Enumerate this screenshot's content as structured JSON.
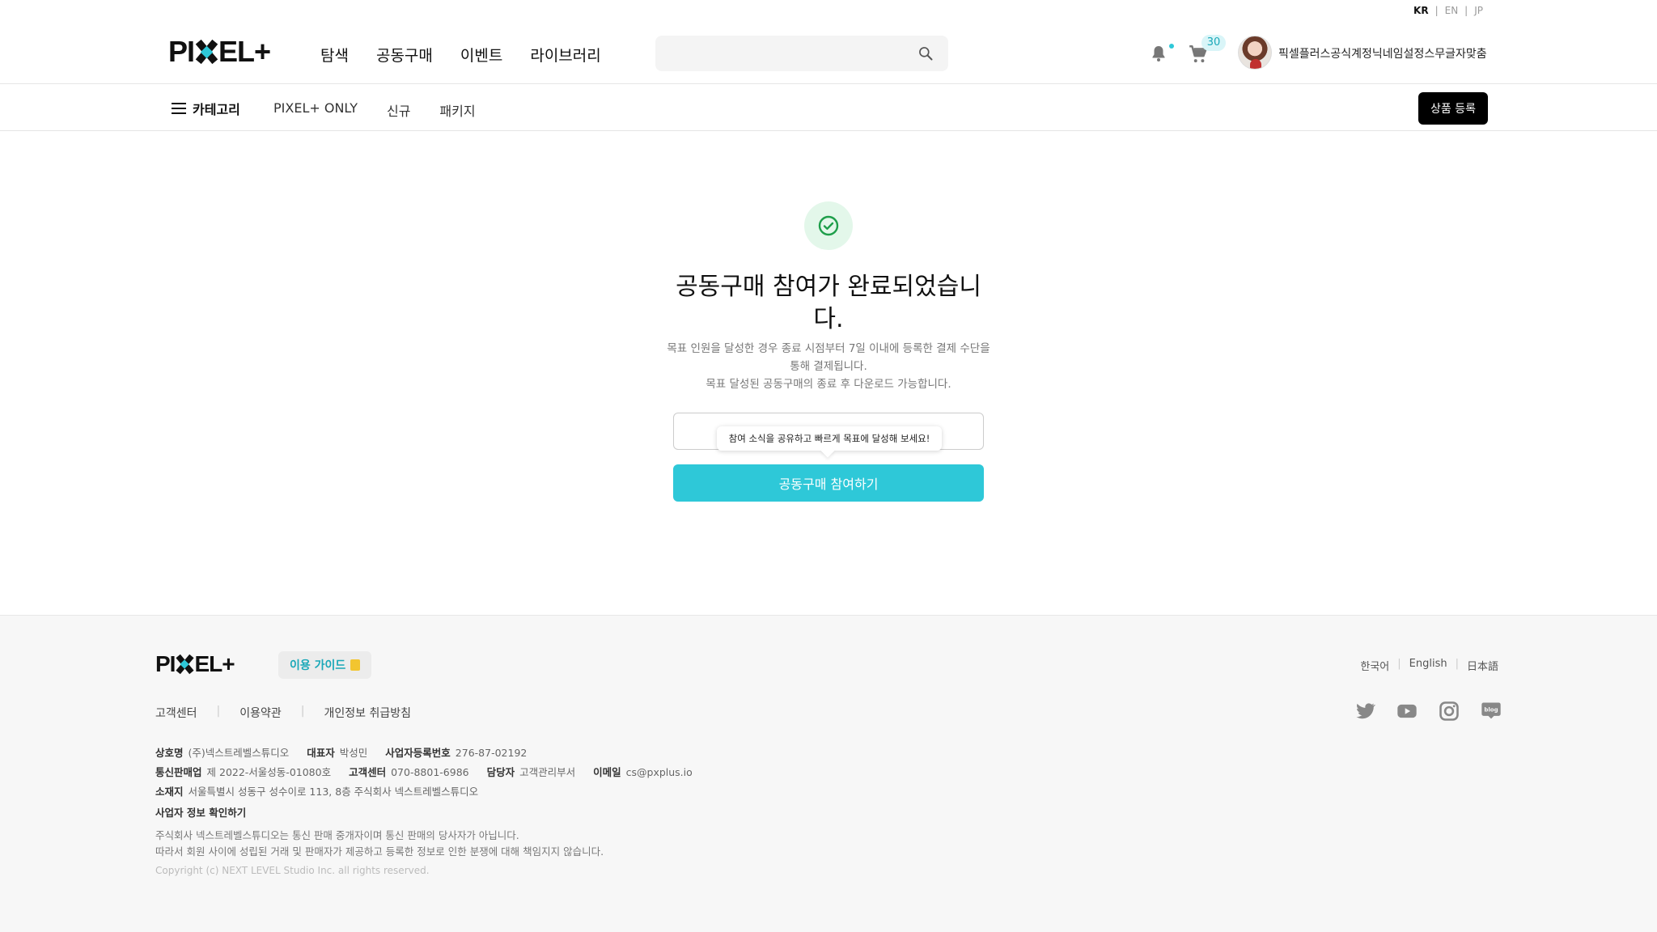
{
  "lang_top": {
    "kr": "KR",
    "en": "EN",
    "jp": "JP",
    "sep": "|"
  },
  "header": {
    "logo_text_left": "PI",
    "logo_text_right": "EL+",
    "nav": [
      "탐색",
      "공동구매",
      "이벤트",
      "라이브러리"
    ],
    "search_placeholder": "",
    "cart_count": "30",
    "username": "픽셀플러스공식계정닉네임설정스무글자맞춤"
  },
  "subnav": {
    "category_label": "카테고리",
    "links": [
      "PIXEL+ ONLY",
      "신규",
      "패키지"
    ],
    "register_label": "상품 등록"
  },
  "main": {
    "title": "공동구매 참여가 완료되었습니다.",
    "desc_line1": "목표 인원을 달성한 경우 종료 시점부터 7일 이내에 등록한 결제 수단을 통해 결제됩니다.",
    "desc_line2": "목표 달성된 공동구매의 종료 후 다운로드 가능합니다.",
    "tooltip": "참여 소식을 공유하고 빠르게 목표에 달성해 보세요!",
    "join_button": "공동구매 참여하기"
  },
  "footer": {
    "logo_text_left": "PI",
    "logo_text_right": "EL+",
    "guide_label": "이용 가이드",
    "languages": [
      "한국어",
      "English",
      "日本語"
    ],
    "links": [
      "고객센터",
      "이용약관",
      "개인정보 취급방침"
    ],
    "info": {
      "company_label": "상호명",
      "company": "(주)넥스트레벨스튜디오",
      "ceo_label": "대표자",
      "ceo": "박성민",
      "bizno_label": "사업자등록번호",
      "bizno": "276-87-02192",
      "mail_order_label": "통신판매업",
      "mail_order": "제 2022-서울성동-01080호",
      "cs_label": "고객센터",
      "cs": "070-8801-6986",
      "manager_label": "담당자",
      "manager": "고객관리부서",
      "email_label": "이메일",
      "email": "cs@pxplus.io",
      "address_label": "소재지",
      "address": "서울특별시 성동구 성수이로 113, 8층 주식회사 넥스트레벨스튜디오"
    },
    "biz_check": "사업자 정보 확인하기",
    "disclaimer1": "주식회사 넥스트레벨스튜디오는 통신 판매 중개자이며 통신 판매의 당사자가 아닙니다.",
    "disclaimer2": "따라서 회원 사이에 성립된 거래 및 판매자가 제공하고 등록한 정보로 인한 분쟁에 대해 책임지지 않습니다.",
    "copyright": "Copyright (c) NEXT LEVEL Studio Inc. all rights reserved.",
    "blog_label": "blog"
  },
  "colors": {
    "accent": "#2ec8d8",
    "success": "#1e9e4a"
  }
}
